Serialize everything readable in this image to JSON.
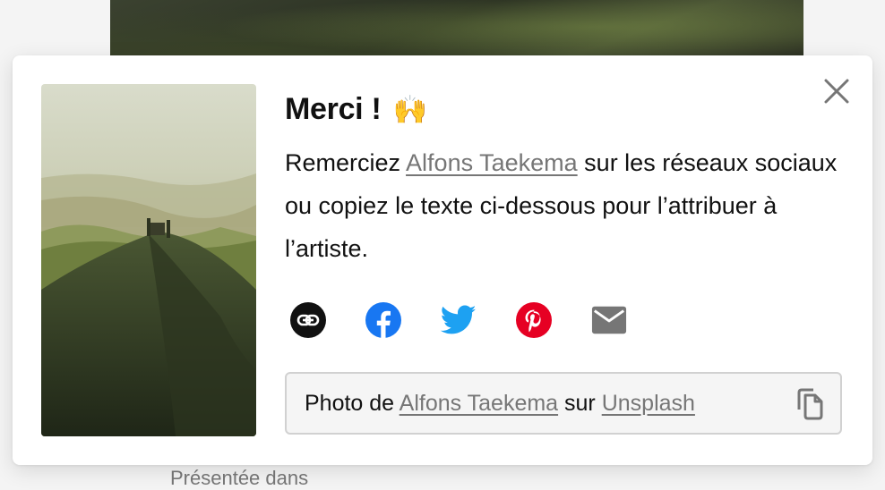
{
  "background": {
    "partial_text": "Présentée dans"
  },
  "modal": {
    "title": "Merci !",
    "title_emoji": "🙌",
    "desc_pre": "Remerciez ",
    "author_name": "Alfons Taekema",
    "desc_post": " sur les réseaux sociaux ou copiez le texte ci-dessous pour l’attribuer à l’artiste.",
    "share_icons": [
      "link-icon",
      "facebook-icon",
      "twitter-icon",
      "pinterest-icon",
      "email-icon"
    ],
    "credit": {
      "prefix": "Photo de ",
      "author": "Alfons Taekema",
      "middle": " sur ",
      "platform": "Unsplash"
    },
    "colors": {
      "facebook": "#1877f2",
      "twitter": "#1da1f2",
      "pinterest": "#e60023",
      "email": "#767676",
      "link": "#111111"
    }
  }
}
